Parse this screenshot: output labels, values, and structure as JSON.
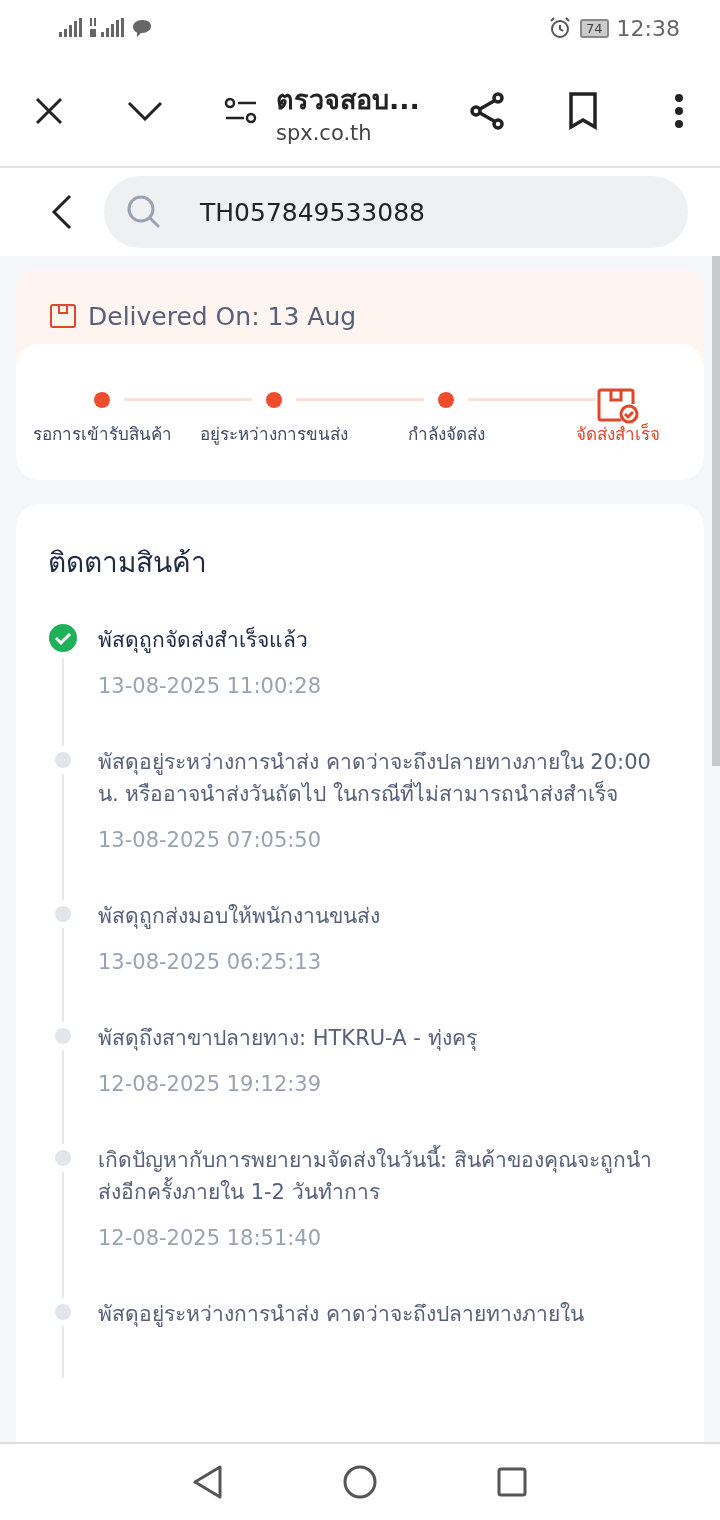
{
  "status_bar": {
    "battery": "74",
    "time": "12:38"
  },
  "browser": {
    "title": "ตรวจสอบ...",
    "domain": "spx.co.th"
  },
  "search": {
    "value": "TH057849533088"
  },
  "delivery": {
    "label": "Delivered On: 13 Aug"
  },
  "steps": [
    {
      "label": "รอการเข้ารับสินค้า",
      "current": false
    },
    {
      "label": "อยู่ระหว่างการขนส่ง",
      "current": false
    },
    {
      "label": "กำลังจัดส่ง",
      "current": false
    },
    {
      "label": "จัดส่งสำเร็จ",
      "current": true
    }
  ],
  "tracking": {
    "title": "ติดตามสินค้า",
    "events": [
      {
        "text": "พัสดุถูกจัดส่งสำเร็จแล้ว",
        "time": "13-08-2025 11:00:28",
        "done": true
      },
      {
        "text": "พัสดุอยู่ระหว่างการนำส่ง คาดว่าจะถึงปลายทางภายใน 20:00 น. หรืออาจนำส่งวันถัดไป ในกรณีที่ไม่สามารถนำส่งสำเร็จ",
        "time": "13-08-2025 07:05:50",
        "done": false
      },
      {
        "text": "พัสดุถูกส่งมอบให้พนักงานขนส่ง",
        "time": "13-08-2025 06:25:13",
        "done": false
      },
      {
        "text": "พัสดุถึงสาขาปลายทาง: HTKRU-A - ทุ่งครุ",
        "time": "12-08-2025 19:12:39",
        "done": false
      },
      {
        "text": "เกิดปัญหากับการพยายามจัดส่งในวันนี้: สินค้าของคุณจะถูกนำส่งอีกครั้งภายใน 1-2 วันทำการ",
        "time": "12-08-2025 18:51:40",
        "done": false
      },
      {
        "text": "พัสดุอยู่ระหว่างการนำส่ง คาดว่าจะถึงปลายทางภายใน",
        "done": false
      }
    ]
  }
}
